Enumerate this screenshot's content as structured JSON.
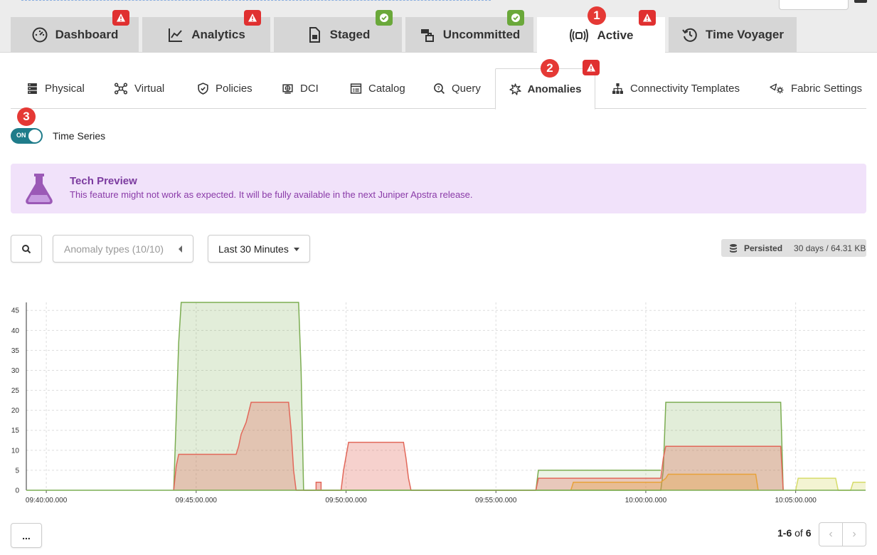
{
  "main_tabs": [
    {
      "label": "Dashboard",
      "icon": "dashboard-gauge-icon",
      "badge": "warn"
    },
    {
      "label": "Analytics",
      "icon": "analytics-line-icon",
      "badge": "warn"
    },
    {
      "label": "Staged",
      "icon": "staged-document-icon",
      "badge": "ok"
    },
    {
      "label": "Uncommitted",
      "icon": "uncommitted-boxes-icon",
      "badge": "ok"
    },
    {
      "label": "Active",
      "icon": "active-broadcast-icon",
      "badge": "warn",
      "active": true
    },
    {
      "label": "Time Voyager",
      "icon": "history-icon"
    }
  ],
  "steps": [
    "1",
    "2",
    "3"
  ],
  "sub_tabs": [
    {
      "label": "Physical",
      "icon": "physical-servers-icon"
    },
    {
      "label": "Virtual",
      "icon": "virtual-network-icon"
    },
    {
      "label": "Policies",
      "icon": "shield-icon"
    },
    {
      "label": "DCI",
      "icon": "dci-globe-icon"
    },
    {
      "label": "Catalog",
      "icon": "catalog-icon"
    },
    {
      "label": "Query",
      "icon": "query-search-icon"
    },
    {
      "label": "Anomalies",
      "icon": "anomalies-burst-icon",
      "active": true,
      "badge": "warn"
    },
    {
      "label": "Connectivity Templates",
      "icon": "connectivity-tree-icon"
    },
    {
      "label": "Fabric Settings",
      "icon": "fabric-settings-icon"
    }
  ],
  "toggle": {
    "state": "ON",
    "label": "Time Series"
  },
  "preview": {
    "title": "Tech Preview",
    "message": "This feature might not work as expected. It will be fully available in the next Juniper Apstra release."
  },
  "controls": {
    "anomaly_types": "Anomaly types (10/10)",
    "time_range": "Last 30 Minutes",
    "persisted_label": "Persisted",
    "persisted_value": "30 days / 64.31 KB"
  },
  "chart_data": {
    "type": "area",
    "x_ticks": [
      "09:40:00.000",
      "09:45:00.000",
      "09:50:00.000",
      "09:55:00.000",
      "10:00:00.000",
      "10:05:00.000"
    ],
    "y_ticks": [
      0,
      5,
      10,
      15,
      20,
      25,
      30,
      35,
      40,
      45
    ],
    "xlim": [
      "09:39:20",
      "10:07:20"
    ],
    "ylim": [
      0,
      47
    ],
    "grid": true,
    "series": [
      {
        "color": "#7cad52",
        "fill": "rgba(124,173,82,0.22)",
        "points": [
          [
            "09:44:15",
            0
          ],
          [
            "09:44:20",
            18
          ],
          [
            "09:44:25",
            37
          ],
          [
            "09:44:30",
            47
          ],
          [
            "09:48:25",
            47
          ],
          [
            "09:48:30",
            30
          ],
          [
            "09:48:35",
            0
          ],
          [
            "10:00:30",
            0
          ],
          [
            "10:00:35",
            5
          ],
          [
            "10:00:40",
            22
          ],
          [
            "10:04:30",
            22
          ],
          [
            "10:04:35",
            0
          ]
        ]
      },
      {
        "color": "#7cad52",
        "fill": "rgba(124,173,82,0.15)",
        "points": [
          [
            "09:56:20",
            0
          ],
          [
            "09:56:25",
            5
          ],
          [
            "10:00:30",
            5
          ]
        ]
      },
      {
        "color": "#e2685a",
        "fill": "rgba(226,104,90,0.30)",
        "points": [
          [
            "09:44:15",
            0
          ],
          [
            "09:44:20",
            6
          ],
          [
            "09:44:25",
            9
          ],
          [
            "09:46:20",
            9
          ],
          [
            "09:46:25",
            11
          ],
          [
            "09:46:30",
            14
          ],
          [
            "09:46:40",
            17
          ],
          [
            "09:46:50",
            22
          ],
          [
            "09:48:05",
            22
          ],
          [
            "09:48:10",
            15
          ],
          [
            "09:48:15",
            5
          ],
          [
            "09:48:20",
            0
          ],
          [
            "09:49:50",
            0
          ],
          [
            "09:49:55",
            5
          ],
          [
            "09:50:05",
            12
          ],
          [
            "09:51:55",
            12
          ],
          [
            "09:52:00",
            8
          ],
          [
            "09:52:05",
            3
          ],
          [
            "09:52:10",
            0
          ],
          [
            "09:56:20",
            0
          ],
          [
            "09:56:25",
            3
          ],
          [
            "09:59:00",
            3
          ],
          [
            "10:00:30",
            3
          ],
          [
            "10:00:35",
            8
          ],
          [
            "10:00:40",
            11
          ],
          [
            "10:04:30",
            11
          ],
          [
            "10:04:35",
            0
          ]
        ]
      },
      {
        "color": "#e2685a",
        "fill": "rgba(226,104,90,0.40)",
        "points": [
          [
            "09:49:00",
            0
          ],
          [
            "09:49:00",
            2
          ],
          [
            "09:49:10",
            2
          ],
          [
            "09:49:10",
            0
          ]
        ]
      },
      {
        "color": "#e8a23a",
        "fill": "rgba(232,162,58,0.30)",
        "points": [
          [
            "09:57:30",
            0
          ],
          [
            "09:57:35",
            2
          ],
          [
            "10:00:30",
            2
          ],
          [
            "10:00:40",
            3
          ],
          [
            "10:00:45",
            4
          ],
          [
            "10:03:40",
            4
          ],
          [
            "10:03:45",
            0
          ]
        ]
      },
      {
        "color": "#d6dc6a",
        "fill": "rgba(214,220,106,0.30)",
        "points": [
          [
            "10:05:00",
            0
          ],
          [
            "10:05:05",
            3
          ],
          [
            "10:06:20",
            3
          ],
          [
            "10:06:25",
            0
          ],
          [
            "10:06:50",
            0
          ],
          [
            "10:06:55",
            2
          ],
          [
            "10:07:20",
            2
          ]
        ]
      }
    ]
  },
  "footer": {
    "more_label": "...",
    "range_bold": "1-6",
    "range_rest": " of ",
    "total": "6"
  }
}
